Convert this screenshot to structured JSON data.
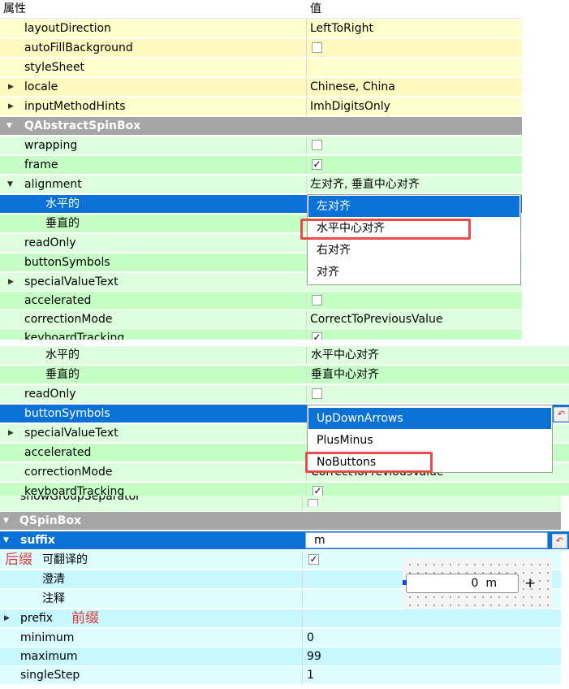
{
  "header": {
    "col_property": "属性",
    "col_value": "值"
  },
  "panel1": {
    "rows": [
      {
        "name": "layoutDirection",
        "value": "LeftToRight"
      },
      {
        "name": "autoFillBackground",
        "value": ""
      },
      {
        "name": "styleSheet",
        "value": ""
      },
      {
        "name": "locale",
        "value": "Chinese, China"
      },
      {
        "name": "inputMethodHints",
        "value": "ImhDigitsOnly"
      },
      {
        "name": "QAbstractSpinBox",
        "value": ""
      },
      {
        "name": "wrapping",
        "value": ""
      },
      {
        "name": "frame",
        "value": ""
      },
      {
        "name": "alignment",
        "value": "左对齐, 垂直中心对齐"
      },
      {
        "name": "水平的",
        "value": ""
      },
      {
        "name": "垂直的",
        "value": ""
      },
      {
        "name": "readOnly",
        "value": ""
      },
      {
        "name": "buttonSymbols",
        "value": ""
      },
      {
        "name": "specialValueText",
        "value": ""
      },
      {
        "name": "accelerated",
        "value": ""
      },
      {
        "name": "correctionMode",
        "value": "CorrectToPreviousValue"
      },
      {
        "name": "keyboardTracking",
        "value": ""
      }
    ],
    "popup": [
      "左对齐",
      "水平中心对齐",
      "右对齐",
      "对齐"
    ]
  },
  "panel2": {
    "rows": [
      {
        "name": "水平的",
        "value": "水平中心对齐"
      },
      {
        "name": "垂直的",
        "value": "垂直中心对齐"
      },
      {
        "name": "readOnly",
        "value": ""
      },
      {
        "name": "buttonSymbols",
        "value": ""
      },
      {
        "name": "specialValueText",
        "value": ""
      },
      {
        "name": "accelerated",
        "value": ""
      },
      {
        "name": "correctionMode",
        "value": "CorrectToPreviousValue"
      },
      {
        "name": "keyboardTracking",
        "value": ""
      }
    ],
    "popup": [
      "UpDownArrows",
      "PlusMinus",
      "NoButtons"
    ]
  },
  "panel3": {
    "partial_row": "showGroupSeparator",
    "rows": [
      {
        "name": "QSpinBox",
        "value": ""
      },
      {
        "name": "suffix",
        "value": "m"
      },
      {
        "name": "可翻译的",
        "value": ""
      },
      {
        "name": "澄清",
        "value": ""
      },
      {
        "name": "注释",
        "value": ""
      },
      {
        "name": "prefix",
        "value": ""
      },
      {
        "name": "minimum",
        "value": "0"
      },
      {
        "name": "maximum",
        "value": "99"
      },
      {
        "name": "singleStep",
        "value": "1"
      }
    ],
    "annotation_suffix": "后缀",
    "annotation_prefix": "前缀",
    "preview_value": "0  m",
    "preview_plus": "+"
  },
  "colors": {
    "selection": "#0a71d6",
    "highlight_box": "#e74c4c",
    "annotation": "#e03a3a"
  }
}
